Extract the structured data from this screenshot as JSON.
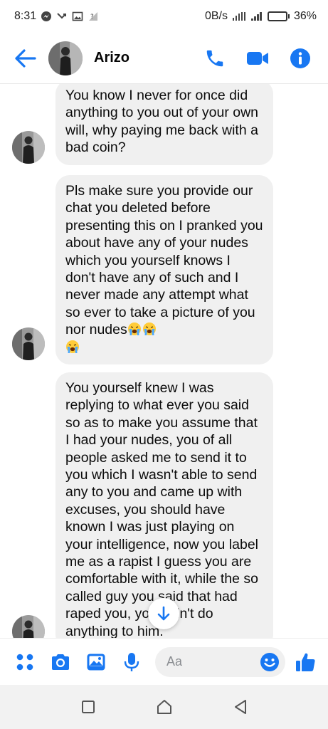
{
  "status_bar": {
    "time": "8:31",
    "network_speed": "0B/s",
    "battery_percent": "36%",
    "battery_level": 0.36,
    "left_icons": [
      "messenger-icon",
      "missed-call-icon",
      "gallery-icon",
      "signal-question-icon"
    ],
    "right_icons": [
      "hotspot-signal-icon",
      "cell-signal-icon"
    ]
  },
  "header": {
    "contact_name": "Arizo",
    "icons": [
      "back-arrow-icon",
      "phone-icon",
      "video-icon",
      "info-icon"
    ]
  },
  "messages": [
    {
      "text": "You know I never for once did anything to you out of your own will, why paying me back with a bad coin?"
    },
    {
      "text": "Pls make sure you provide our chat you deleted before presenting this on I pranked you about have any of your nudes which you yourself knows I don't have any of such and I never made any attempt what so ever to take a picture of you nor nudes",
      "emojis": [
        "loudly-crying-face",
        "loudly-crying-face",
        "loudly-crying-face"
      ]
    },
    {
      "text": "You yourself knew I was replying to what ever you said so as to make you assume that I had your nudes, you of all people asked me to send it to you which I wasn't able to send any to you and came up with excuses, you should have known I was just playing on your intelligence, now you label me as a rapist I guess you are comfortable with it, while the so called guy you said that had raped you, you didn't do anything to him."
    }
  ],
  "composer": {
    "placeholder": "Aa",
    "icons": [
      "apps-grid-icon",
      "camera-icon",
      "image-icon",
      "microphone-icon",
      "emoji-icon",
      "thumbs-up-icon"
    ]
  },
  "colors": {
    "accent": "#1877f2",
    "bubble": "#f0f0f0",
    "text": "#050505",
    "navbar": "#f2f2f2"
  }
}
